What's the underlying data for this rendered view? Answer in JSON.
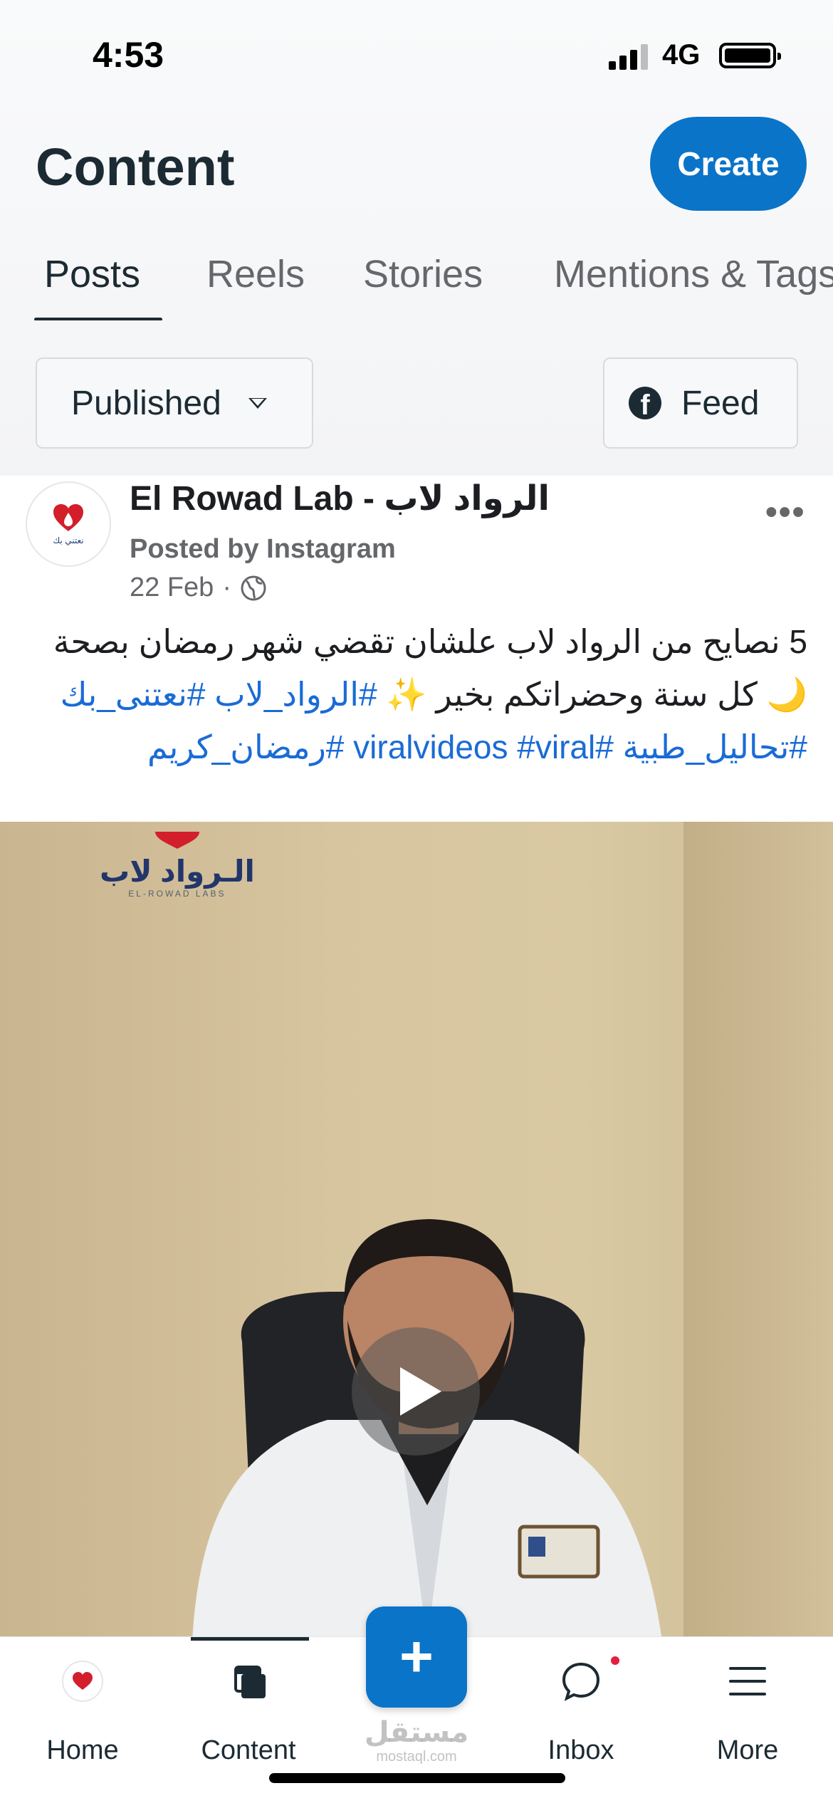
{
  "status_bar": {
    "time": "4:53",
    "network": "4G"
  },
  "header": {
    "title": "Content",
    "create_label": "Create"
  },
  "tabs": [
    {
      "label": "Posts"
    },
    {
      "label": "Reels"
    },
    {
      "label": "Stories"
    },
    {
      "label": "Mentions & Tags"
    }
  ],
  "filters": {
    "status": "Published",
    "feed": "Feed"
  },
  "post": {
    "page_name": "El Rowad Lab - الرواد لاب",
    "posted_by": "Posted by Instagram",
    "date": "22 Feb",
    "date_separator": "·",
    "caption_text": "5 نصايح من الرواد لاب علشان تقضي شهر رمضان بصحة 🌙 كل سنة وحضراتكم بخير ✨ ",
    "caption_tags": "#الرواد_لاب #نعتنى_بك #تحاليل_طبية #viralvideos #viral #رمضان_كريم",
    "video_logo_text": "الـرواد لاب",
    "video_logo_subtext": "EL-ROWAD LABS",
    "avatar_text": "نعتني بك"
  },
  "bottom_nav": {
    "home": "Home",
    "content": "Content",
    "inbox": "Inbox",
    "more": "More",
    "fab": "+"
  },
  "watermark": {
    "arabic": "مستقل",
    "latin": "mostaql.com"
  },
  "colors": {
    "accent": "#0a74c8",
    "hashtag": "#1a6bd6",
    "notification": "#e41e3f"
  }
}
